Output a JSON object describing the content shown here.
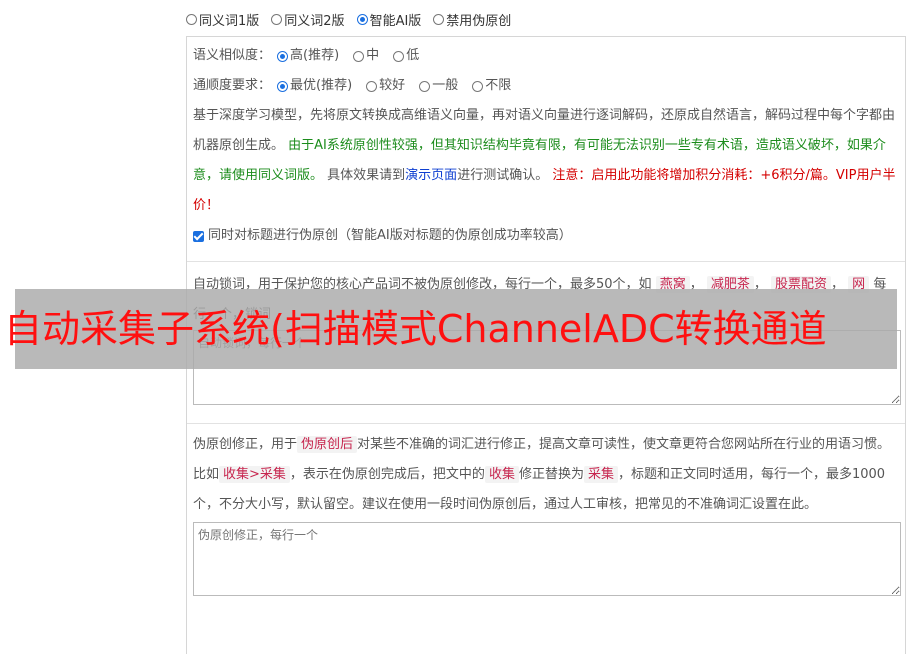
{
  "modes": [
    {
      "label": "同义词1版",
      "selected": false
    },
    {
      "label": "同义词2版",
      "selected": false
    },
    {
      "label": "智能AI版",
      "selected": true
    },
    {
      "label": "禁用伪原创",
      "selected": false
    }
  ],
  "similarity": {
    "label": "语义相似度：",
    "options": [
      {
        "label": "高(推荐)",
        "selected": true
      },
      {
        "label": "中",
        "selected": false
      },
      {
        "label": "低",
        "selected": false
      }
    ]
  },
  "fluency": {
    "label": "通顺度要求：",
    "options": [
      {
        "label": "最优(推荐)",
        "selected": true
      },
      {
        "label": "较好",
        "selected": false
      },
      {
        "label": "一般",
        "selected": false
      },
      {
        "label": "不限",
        "selected": false
      }
    ]
  },
  "description": {
    "p1": "基于深度学习模型，先将原文转换成高维语义向量，再对语义向量进行逐词解码，还原成自然语言，解码过程中每个字都由机器原创生成。",
    "p2_green": "由于AI系统原创性较强，但其知识结构毕竟有限，有可能无法识别一些专有术语，造成语义破坏，如果介意，请使用同义词版。",
    "p3_pre": "具体效果请到",
    "p3_link": "演示页面",
    "p3_post": "进行测试确认。",
    "p4_red": "注意：启用此功能将增加积分消耗：+6积分/篇。VIP用户半价！"
  },
  "title_checkbox": {
    "label": "同时对标题进行伪原创（智能AI版对标题的伪原创成功率较高）",
    "checked": true
  },
  "lock_words": {
    "desc_pre": "自动锁词，用于保护您的核心产品词不被伪原创修改，每行一个，最多50个，如",
    "tags": [
      "燕窝",
      "减肥茶",
      "股票配资",
      "网"
    ],
    "desc_line2": "每行一个，锁词",
    "placeholder": "自动锁词，每行一个"
  },
  "correction": {
    "d1": "伪原创修正，用于",
    "tag1": "伪原创后",
    "d2": "对某些不准确的词汇进行修正，提高文章可读性，使文章更符合您网站所在行业的用语习惯。比如",
    "tag2": "收集>采集",
    "d3": "，表示在伪原创完成后，把文中的",
    "tag3": "收集",
    "d4": "修正替换为",
    "tag4": "采集",
    "d5": "，标题和正文同时适用，每行一个，最多1000个，不分大小写，默认留空。建议在使用一段时间伪原创后，通过人工审核，把常见的不准确词汇设置在此。",
    "placeholder": "伪原创修正，每行一个"
  },
  "overlay_text": "自动采集子系统(扫描模式ChannelADC转换通道"
}
